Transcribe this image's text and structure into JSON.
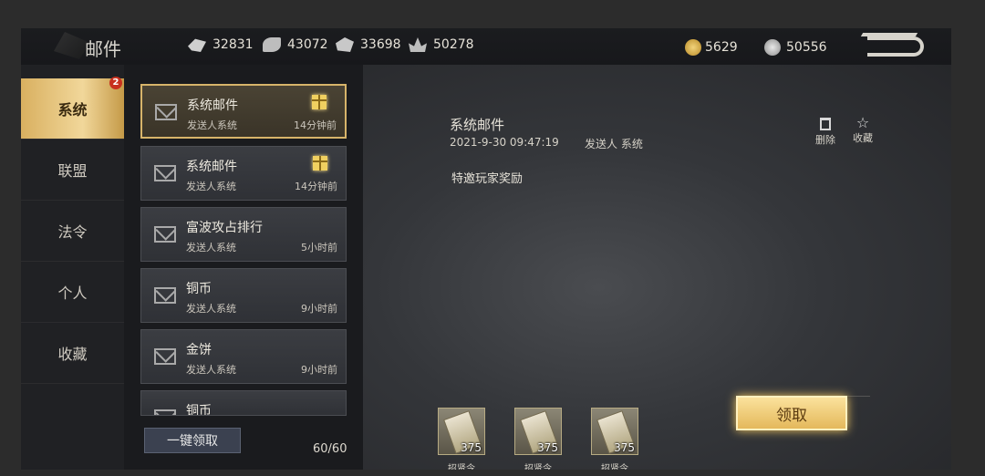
{
  "window": {
    "title": "邮件"
  },
  "resources": [
    {
      "icon": "food-icon",
      "value": "32831"
    },
    {
      "icon": "wood-icon",
      "value": "43072"
    },
    {
      "icon": "stone-icon",
      "value": "33698"
    },
    {
      "icon": "iron-icon",
      "value": "50278"
    }
  ],
  "currencies": [
    {
      "icon": "gold-coin-icon",
      "value": "5629"
    },
    {
      "icon": "silver-coin-icon",
      "value": "50556"
    }
  ],
  "tabs": [
    {
      "label": "系统",
      "badge": "2",
      "active": true
    },
    {
      "label": "联盟"
    },
    {
      "label": "法令"
    },
    {
      "label": "个人"
    },
    {
      "label": "收藏"
    }
  ],
  "mails": [
    {
      "title": "系统邮件",
      "sender": "发送人系统",
      "time": "14分钟前",
      "has_gift": true,
      "active": true
    },
    {
      "title": "系统邮件",
      "sender": "发送人系统",
      "time": "14分钟前",
      "has_gift": true
    },
    {
      "title": "富波攻占排行",
      "sender": "发送人系统",
      "time": "5小时前"
    },
    {
      "title": "铜币",
      "sender": "发送人系统",
      "time": "9小时前"
    },
    {
      "title": "金饼",
      "sender": "发送人系统",
      "time": "9小时前"
    },
    {
      "title": "铜币",
      "sender": "",
      "time": ""
    }
  ],
  "list_footer": {
    "claim_all_label": "一键领取",
    "count": "60/60"
  },
  "detail": {
    "title": "系统邮件",
    "datetime": "2021-9-30 09:47:19",
    "sender": "发送人 系统",
    "body": "特邀玩家奖励",
    "delete_label": "删除",
    "favorite_label": "收藏",
    "rewards": [
      {
        "name": "招贤令",
        "qty": "375"
      },
      {
        "name": "招贤令",
        "qty": "375"
      },
      {
        "name": "招贤令",
        "qty": "375"
      }
    ],
    "claim_label": "领取"
  }
}
